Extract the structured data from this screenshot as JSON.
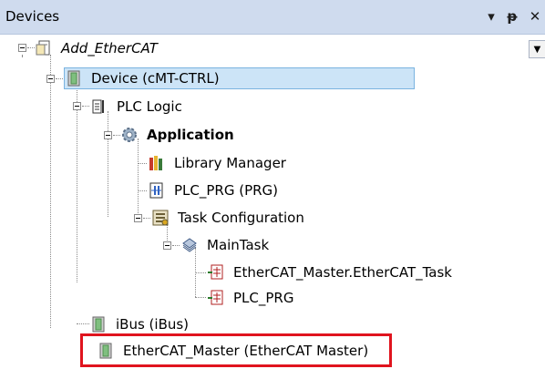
{
  "panel": {
    "title": "Devices",
    "dropdown_glyph": "▾",
    "pin_glyph": "ᵽ",
    "close_glyph": "✕"
  },
  "tree": {
    "project": "Add_EtherCAT",
    "device": "Device (cMT-CTRL)",
    "plc_logic": "PLC Logic",
    "application": "Application",
    "library_manager": "Library Manager",
    "plc_prg": "PLC_PRG (PRG)",
    "task_configuration": "Task Configuration",
    "main_task": "MainTask",
    "ethercat_task_call": "EtherCAT_Master.EtherCAT_Task",
    "plc_prg_call": "PLC_PRG",
    "ibus": "iBus (iBus)",
    "ethercat_master": "EtherCAT_Master (EtherCAT Master)"
  },
  "colors": {
    "titlebar": "#cfdbee",
    "selection": "#cce4f7",
    "highlight": "#e0141e"
  }
}
